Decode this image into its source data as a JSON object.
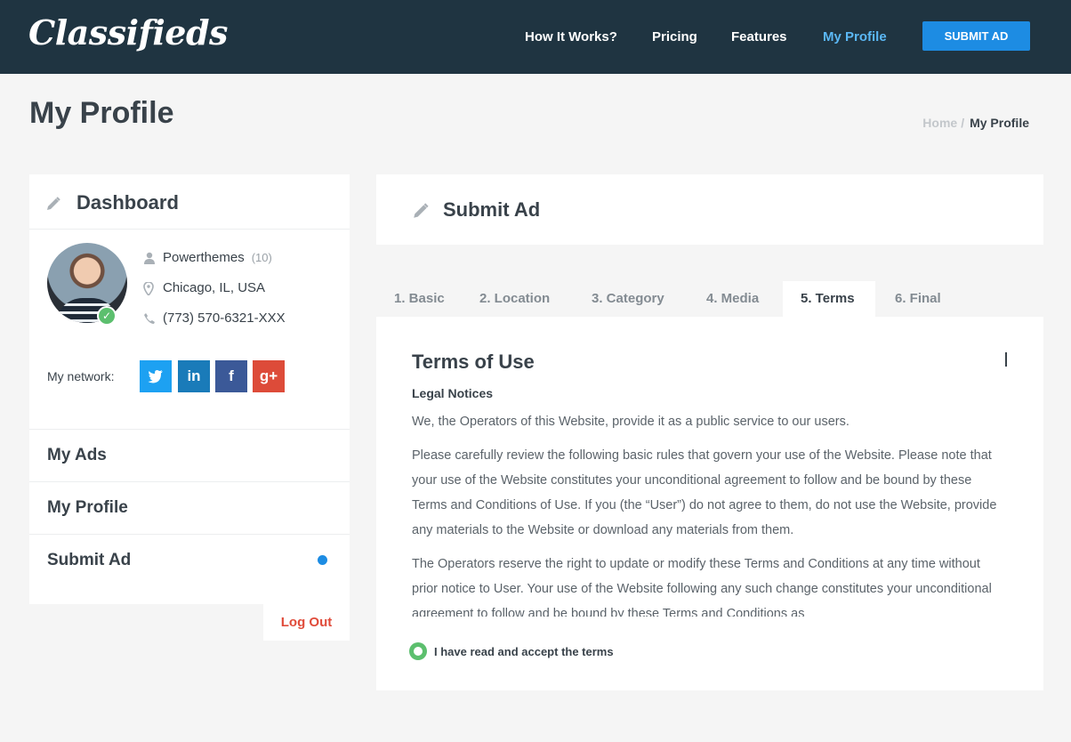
{
  "header": {
    "logo": "Classifieds",
    "nav": [
      "How It Works?",
      "Pricing",
      "Features",
      "My Profile"
    ],
    "submit_label": "SUBMIT AD"
  },
  "page": {
    "title": "My Profile",
    "breadcrumb": {
      "home": "Home",
      "separator": "/",
      "current": "My Profile"
    }
  },
  "sidebar": {
    "title": "Dashboard",
    "user": {
      "name": "Powerthemes",
      "count": "(10)",
      "location": "Chicago, IL, USA",
      "phone": "(773) 570-6321-XXX"
    },
    "network_label": "My network:",
    "social": [
      {
        "name": "twitter",
        "glyph": "🐦",
        "color": "#1da1f2"
      },
      {
        "name": "linkedin",
        "glyph": "in",
        "color": "#1a7bb9"
      },
      {
        "name": "facebook",
        "glyph": "f",
        "color": "#3b5998"
      },
      {
        "name": "google-plus",
        "glyph": "g+",
        "color": "#dd4b39"
      }
    ],
    "menu": [
      "My Ads",
      "My Profile",
      "Submit Ad"
    ],
    "logout": "Log Out"
  },
  "main": {
    "title": "Submit Ad",
    "tabs": [
      "1. Basic",
      "2. Location",
      "3. Category",
      "4. Media",
      "5. Terms",
      "6. Final"
    ],
    "active_tab": "5. Terms",
    "terms": {
      "title": "Terms of Use",
      "subtitle": "Legal Notices",
      "paragraphs": [
        "We, the Operators of this Website, provide it as a public service to our users.",
        "Please carefully review the following basic rules that govern your use of the Website. Please note that your use of the Website constitutes your unconditional agreement to follow and be bound by these Terms and Conditions of Use. If you (the “User”) do not agree to them, do not use the Website, provide any materials to the Website or download any materials from them.",
        "The Operators reserve the right to update or modify these Terms and Conditions at any time without prior notice to User. Your use of the Website following any such change constitutes your unconditional agreement to follow and be bound by these Terms and Conditions as"
      ],
      "accept_label": "I have read and accept the terms"
    }
  },
  "colors": {
    "header_bg": "#1f3441",
    "accent": "#1d8ce3",
    "active_nav": "#5bb8f5",
    "logout": "#e04b3a",
    "check": "#5cbf6e"
  }
}
